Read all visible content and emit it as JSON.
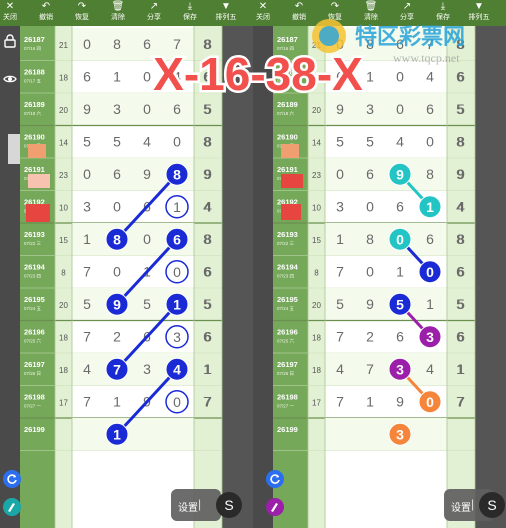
{
  "banner": {
    "text": "X-16-38-X",
    "color": "#f2504d"
  },
  "watermark": {
    "name": "特区彩票网",
    "url": "www.tqcp.net"
  },
  "toolbar": {
    "left": [
      {
        "icon": "close-icon",
        "label": "关闭"
      },
      {
        "icon": "undo-icon",
        "label": "撤销"
      },
      {
        "icon": "redo-icon",
        "label": "恢复"
      },
      {
        "icon": "trash-icon",
        "label": "清除"
      },
      {
        "icon": "share-icon",
        "label": "分享"
      },
      {
        "icon": "download-icon",
        "label": "保存"
      },
      {
        "icon": "triangle-down-icon",
        "label": "排列五"
      }
    ],
    "right": [
      {
        "icon": "close-icon",
        "label": "关闭"
      },
      {
        "icon": "undo-icon",
        "label": "撤销"
      },
      {
        "icon": "redo-icon",
        "label": "恢复"
      },
      {
        "icon": "trash-icon",
        "label": "清除"
      },
      {
        "icon": "share-icon",
        "label": "分享"
      },
      {
        "icon": "download-icon",
        "label": "保存"
      },
      {
        "icon": "triangle-down-icon",
        "label": "排列五"
      }
    ]
  },
  "rows": [
    {
      "period": "26187",
      "date": "07/16 四",
      "sum": "21",
      "digits": [
        "0",
        "8",
        "6",
        "7",
        "8"
      ],
      "tail": "8"
    },
    {
      "period": "26188",
      "date": "07/17 五",
      "sum": "18",
      "digits": [
        "6",
        "1",
        "0",
        "4",
        "6"
      ],
      "tail": "6"
    },
    {
      "period": "26189",
      "date": "07/18 六",
      "sum": "20",
      "digits": [
        "9",
        "3",
        "0",
        "6",
        "5"
      ],
      "tail": "5"
    },
    {
      "period": "26190",
      "date": "07/19 日",
      "sum": "14",
      "digits": [
        "5",
        "5",
        "4",
        "0",
        "8"
      ],
      "tail": "8"
    },
    {
      "period": "26191",
      "date": "07/20 一",
      "sum": "23",
      "digits": [
        "0",
        "6",
        "9",
        "8",
        "9"
      ],
      "tail": "9"
    },
    {
      "period": "26192",
      "date": "07/21 二",
      "sum": "10",
      "digits": [
        "3",
        "0",
        "6",
        "1",
        "4"
      ],
      "tail": "4"
    },
    {
      "period": "26193",
      "date": "07/22 三",
      "sum": "15",
      "digits": [
        "1",
        "8",
        "0",
        "6",
        "8"
      ],
      "tail": "8"
    },
    {
      "period": "26194",
      "date": "07/23 四",
      "sum": "8",
      "digits": [
        "7",
        "0",
        "1",
        "0",
        "6"
      ],
      "tail": "6"
    },
    {
      "period": "26195",
      "date": "07/24 五",
      "sum": "20",
      "digits": [
        "5",
        "9",
        "5",
        "1",
        "5"
      ],
      "tail": "5"
    },
    {
      "period": "26196",
      "date": "07/25 六",
      "sum": "18",
      "digits": [
        "7",
        "2",
        "6",
        "3",
        "6"
      ],
      "tail": "6"
    },
    {
      "period": "26197",
      "date": "07/26 日",
      "sum": "18",
      "digits": [
        "4",
        "7",
        "3",
        "4",
        "1"
      ],
      "tail": "1"
    },
    {
      "period": "26198",
      "date": "07/27 一",
      "sum": "17",
      "digits": [
        "7",
        "1",
        "9",
        "0",
        "7"
      ],
      "tail": "7"
    },
    {
      "period": "26199",
      "date": "",
      "sum": "",
      "digits": [
        "",
        "",
        "",
        "",
        ""
      ],
      "tail": ""
    }
  ],
  "marks_left": [
    {
      "row": 4,
      "col": 3,
      "style": "filled",
      "value": "8"
    },
    {
      "row": 5,
      "col": 3,
      "style": "ring",
      "value": "1"
    },
    {
      "row": 6,
      "col": 1,
      "style": "filled",
      "value": "8"
    },
    {
      "row": 6,
      "col": 3,
      "style": "filled",
      "value": "6"
    },
    {
      "row": 7,
      "col": 3,
      "style": "ring",
      "value": "0"
    },
    {
      "row": 8,
      "col": 1,
      "style": "filled",
      "value": "9"
    },
    {
      "row": 8,
      "col": 3,
      "style": "filled",
      "value": "1"
    },
    {
      "row": 9,
      "col": 3,
      "style": "ring",
      "value": "3"
    },
    {
      "row": 10,
      "col": 1,
      "style": "filled",
      "value": "7"
    },
    {
      "row": 10,
      "col": 3,
      "style": "filled",
      "value": "4"
    },
    {
      "row": 11,
      "col": 3,
      "style": "ring",
      "value": "0"
    },
    {
      "row": 12,
      "col": 1,
      "style": "filled",
      "value": "1"
    }
  ],
  "links_left": [
    [
      4,
      3,
      6,
      1
    ],
    [
      6,
      3,
      8,
      1
    ],
    [
      8,
      3,
      10,
      1
    ],
    [
      10,
      3,
      12,
      1
    ]
  ],
  "marks_right": [
    {
      "row": 4,
      "col": 2,
      "color": "#22c4c4",
      "value": "9"
    },
    {
      "row": 5,
      "col": 3,
      "color": "#22c4c4",
      "value": "1"
    },
    {
      "row": 6,
      "col": 2,
      "color": "#22c4c4",
      "value": "0"
    },
    {
      "row": 7,
      "col": 3,
      "color": "#1a2bd6",
      "value": "0"
    },
    {
      "row": 8,
      "col": 2,
      "color": "#1a2bd6",
      "value": "5"
    },
    {
      "row": 9,
      "col": 3,
      "color": "#9b1fa8",
      "value": "3"
    },
    {
      "row": 10,
      "col": 2,
      "color": "#9b1fa8",
      "value": "3"
    },
    {
      "row": 11,
      "col": 3,
      "color": "#f5853a",
      "value": "0"
    },
    {
      "row": 12,
      "col": 2,
      "color": "#f5853a",
      "value": "3"
    }
  ],
  "links_right": [
    [
      4,
      2,
      5,
      3,
      "#22c4c4"
    ],
    [
      6,
      2,
      7,
      3,
      "#1a2bd6"
    ],
    [
      8,
      2,
      9,
      3,
      "#9b1fa8"
    ],
    [
      10,
      2,
      11,
      3,
      "#f5853a"
    ]
  ],
  "settings": {
    "label": "设置",
    "sep": "|",
    "s": "S"
  },
  "colors": {
    "toolbar": "#4f7f32",
    "stripe": "#e6f4d6",
    "mark_blue": "#1a2bd6",
    "refresh": "#2b6ff0"
  }
}
